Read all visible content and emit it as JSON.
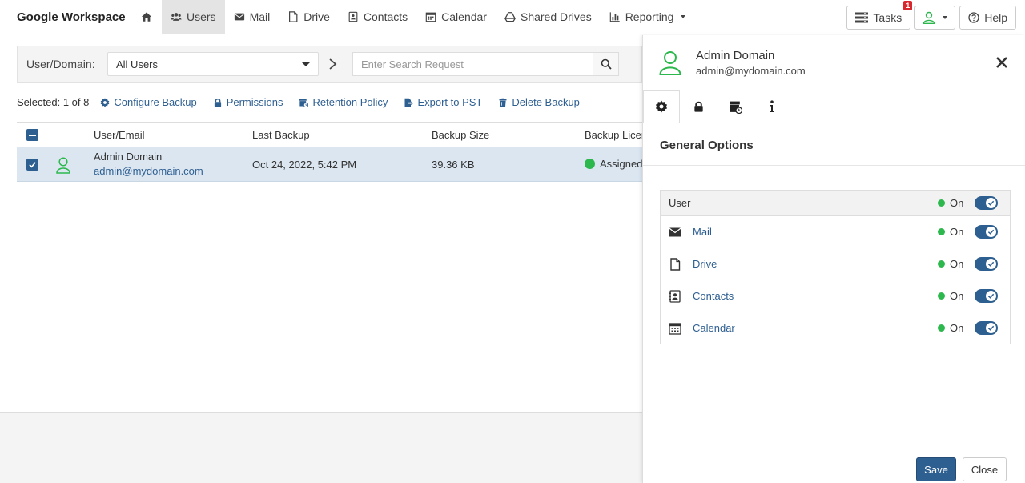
{
  "app": {
    "brand": "Google Workspace"
  },
  "nav": {
    "items": [
      {
        "label": "Users",
        "icon": "users-icon"
      },
      {
        "label": "Mail",
        "icon": "envelope-icon"
      },
      {
        "label": "Drive",
        "icon": "file-icon"
      },
      {
        "label": "Contacts",
        "icon": "address-book-icon"
      },
      {
        "label": "Calendar",
        "icon": "calendar-icon"
      },
      {
        "label": "Shared Drives",
        "icon": "shared-drive-icon"
      },
      {
        "label": "Reporting",
        "icon": "bar-chart-icon"
      }
    ]
  },
  "topright": {
    "tasks_label": "Tasks",
    "tasks_badge": "1",
    "help_label": "Help"
  },
  "filter": {
    "label": "User/Domain:",
    "selected": "All Users",
    "search_placeholder": "Enter Search Request"
  },
  "actions": {
    "selected_text": "Selected: 1 of 8",
    "items": [
      {
        "label": "Configure Backup",
        "icon": "gear-icon"
      },
      {
        "label": "Permissions",
        "icon": "lock-icon"
      },
      {
        "label": "Retention Policy",
        "icon": "retention-icon"
      },
      {
        "label": "Export to PST",
        "icon": "export-icon"
      },
      {
        "label": "Delete Backup",
        "icon": "trash-icon"
      }
    ]
  },
  "table": {
    "columns": [
      "User/Email",
      "Last Backup",
      "Backup Size",
      "Backup Licen"
    ],
    "rows": [
      {
        "name": "Admin Domain",
        "email": "admin@mydomain.com",
        "last_backup": "Oct 24, 2022, 5:42 PM",
        "size": "39.36 KB",
        "license": "Assigned",
        "checked": true
      }
    ]
  },
  "panel": {
    "name": "Admin Domain",
    "email": "admin@mydomain.com",
    "section_title": "General Options",
    "options": [
      {
        "label": "User",
        "status": "On",
        "enabled": true
      },
      {
        "label": "Mail",
        "status": "On",
        "enabled": true,
        "icon": "envelope-icon"
      },
      {
        "label": "Drive",
        "status": "On",
        "enabled": true,
        "icon": "file-icon"
      },
      {
        "label": "Contacts",
        "status": "On",
        "enabled": true,
        "icon": "address-book-icon"
      },
      {
        "label": "Calendar",
        "status": "On",
        "enabled": true,
        "icon": "calendar-icon"
      }
    ],
    "save_label": "Save",
    "close_label": "Close"
  },
  "colors": {
    "accent": "#2e5f91",
    "status_green": "#2db84d",
    "badge_red": "#d9272e",
    "selected_row": "#dbe6f1"
  }
}
